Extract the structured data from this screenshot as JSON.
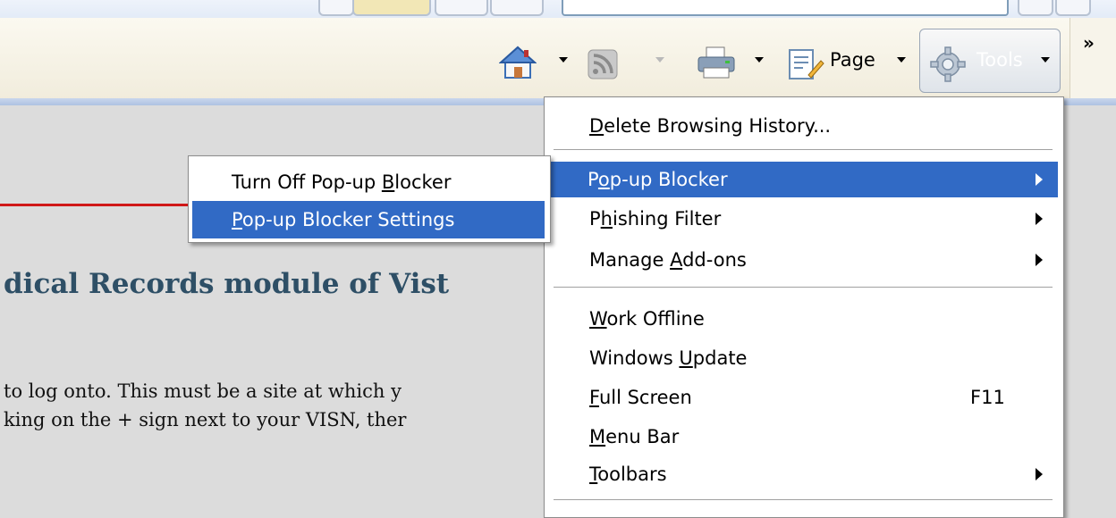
{
  "command_bar": {
    "page_label": "Page",
    "tools_label": "Tools",
    "more_label": "»"
  },
  "tools_menu": {
    "items": [
      {
        "label": "Delete Browsing History...",
        "accel": "D"
      },
      {
        "label": "Pop-up Blocker",
        "accel": "o",
        "highlighted": true,
        "submenu": true
      },
      {
        "label": "Phishing Filter",
        "accel": "h",
        "submenu": true
      },
      {
        "label": "Manage Add-ons",
        "accel": "A",
        "submenu": true
      },
      {
        "label": "Work Offline",
        "accel": "W"
      },
      {
        "label": "Windows Update",
        "accel": "U"
      },
      {
        "label": "Full Screen",
        "accel": "F",
        "shortcut": "F11"
      },
      {
        "label": "Menu Bar",
        "accel": "M"
      },
      {
        "label": "Toolbars",
        "accel": "T",
        "submenu": true
      }
    ]
  },
  "popup_submenu": {
    "items": [
      {
        "label": "Turn Off Pop-up Blocker",
        "accel": "B"
      },
      {
        "label": "Pop-up Blocker Settings",
        "accel": "P",
        "highlighted": true
      }
    ]
  },
  "page": {
    "heading": "dical Records module of Vist",
    "line1": "to log onto. This must be a site at which y",
    "line2": "king on the + sign next to your VISN, ther"
  },
  "colors": {
    "highlight": "#316ac5",
    "heading": "#2e4f66",
    "rule": "#d01818"
  }
}
